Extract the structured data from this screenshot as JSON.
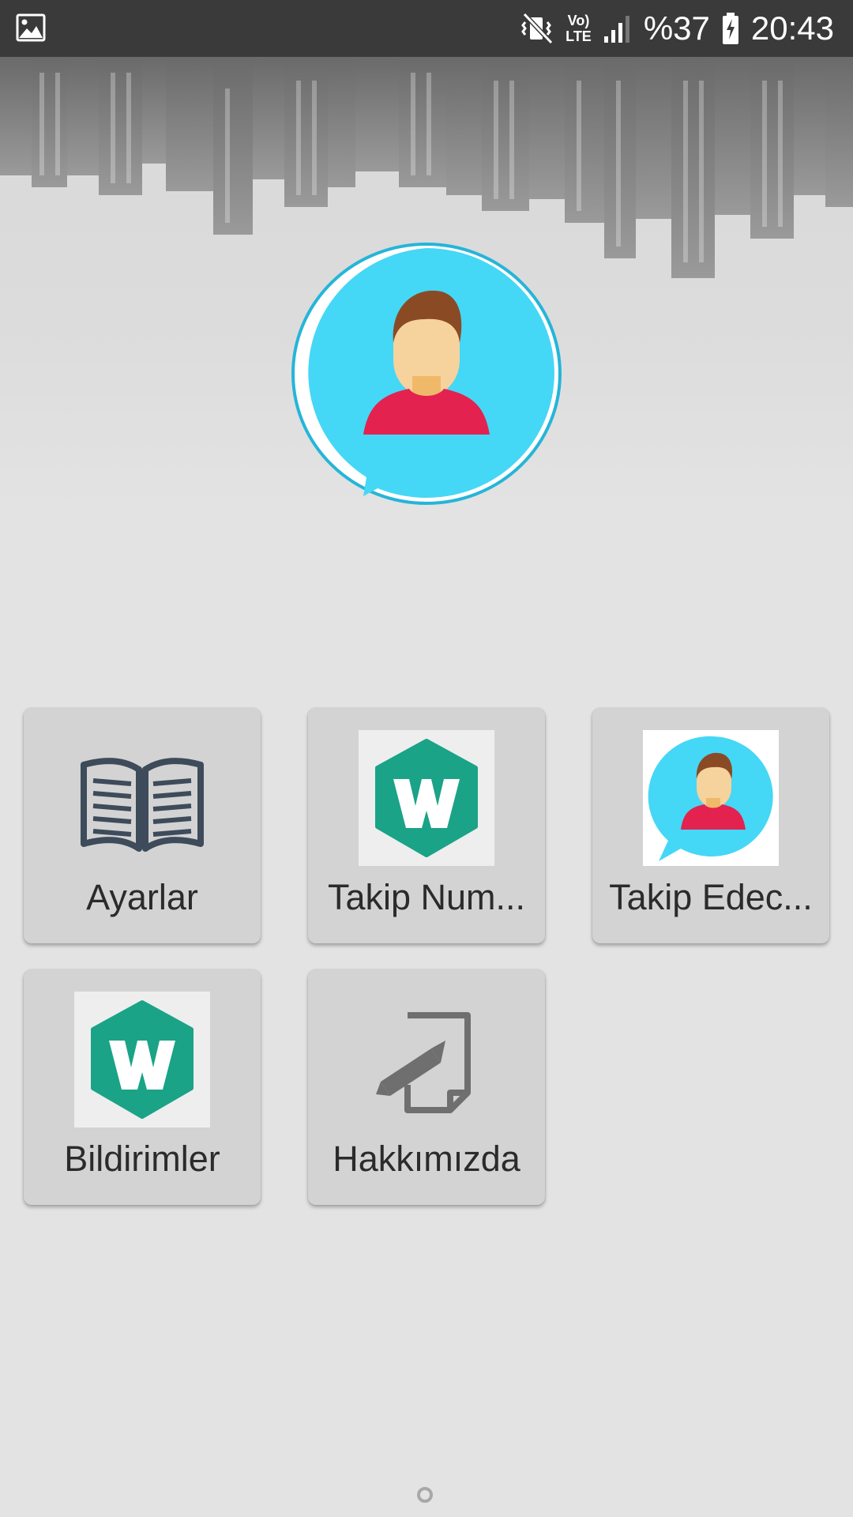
{
  "status_bar": {
    "volte": "Vo)",
    "lte": "LTE",
    "battery_percent": "%37",
    "time": "20:43"
  },
  "menu": [
    {
      "label": "Ayarlar",
      "icon": "book-icon"
    },
    {
      "label": "Takip Num...",
      "icon": "wattpad-icon"
    },
    {
      "label": "Takip Edec...",
      "icon": "user-chat-icon"
    },
    {
      "label": "Bildirimler",
      "icon": "wattpad-icon"
    },
    {
      "label": "Hakkımızda",
      "icon": "edit-note-icon"
    }
  ],
  "colors": {
    "status_bar": "#3a3a3a",
    "background": "#e3e3e3",
    "tile": "#d3d3d3",
    "avatar_blue": "#45d7f6",
    "wattpad_green": "#1aa387",
    "shirt_red": "#e3224f"
  }
}
